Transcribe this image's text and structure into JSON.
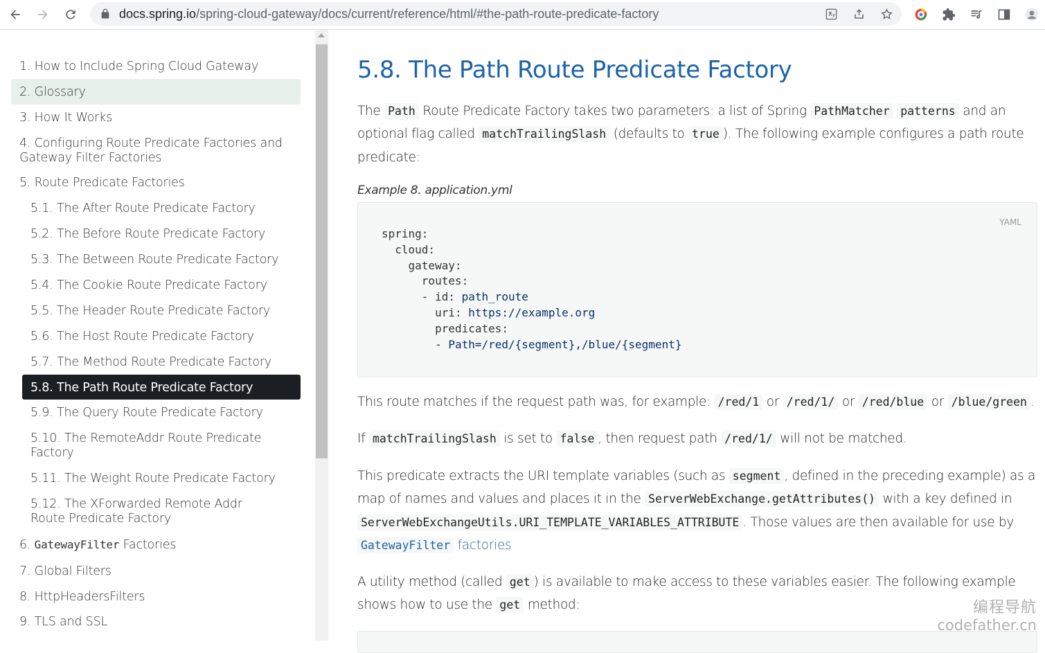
{
  "browser": {
    "url_host": "docs.spring.io",
    "url_path": "/spring-cloud-gateway/docs/current/reference/html/#the-path-route-predicate-factory"
  },
  "toc": {
    "items": [
      {
        "label": "1. How to Include Spring Cloud Gateway"
      },
      {
        "label": "2. Glossary"
      },
      {
        "label": "3. How It Works"
      },
      {
        "label": "4. Configuring Route Predicate Factories and Gateway Filter Factories"
      },
      {
        "label": "5. Route Predicate Factories"
      },
      {
        "label": "5.1. The After Route Predicate Factory"
      },
      {
        "label": "5.2. The Before Route Predicate Factory"
      },
      {
        "label": "5.3. The Between Route Predicate Factory"
      },
      {
        "label": "5.4. The Cookie Route Predicate Factory"
      },
      {
        "label": "5.5. The Header Route Predicate Factory"
      },
      {
        "label": "5.6. The Host Route Predicate Factory"
      },
      {
        "label": "5.7. The Method Route Predicate Factory"
      },
      {
        "label": "5.8. The Path Route Predicate Factory"
      },
      {
        "label": "5.9. The Query Route Predicate Factory"
      },
      {
        "label": "5.10. The RemoteAddr Route Predicate Factory"
      },
      {
        "label": "5.11. The Weight Route Predicate Factory"
      },
      {
        "label": "5.12. The XForwarded Remote Addr Route Predicate Factory"
      },
      {
        "prefix": "6. ",
        "code": "GatewayFilter",
        "suffix": " Factories"
      },
      {
        "label": "7. Global Filters"
      },
      {
        "label": "8. HttpHeadersFilters"
      },
      {
        "label": "9. TLS and SSL"
      }
    ]
  },
  "content": {
    "title": "5.8. The Path Route Predicate Factory",
    "p1": {
      "t1": "The ",
      "c1": "Path",
      "t2": " Route Predicate Factory takes two parameters: a list of Spring ",
      "c2": "PathMatcher",
      "t3": " ",
      "c3": "patterns",
      "t4": " and an optional flag called ",
      "c4": "matchTrailingSlash",
      "t5": " (defaults to ",
      "c5": "true",
      "t6": "). The following example configures a path route predicate:"
    },
    "example_title": "Example 8. application.yml",
    "code_lang": "YAML",
    "code_lines": {
      "l1": "spring:",
      "l2": "  cloud:",
      "l3": "    gateway:",
      "l4": "      routes:",
      "l5k": "      - id: ",
      "l5v": "path_route",
      "l6k": "        uri: ",
      "l6v": "https://example.org",
      "l7": "        predicates:",
      "l8": "        - Path=/red/{segment},/blue/{segment}"
    },
    "p2": {
      "t1": "This route matches if the request path was, for example: ",
      "c1": "/red/1",
      "t2": " or ",
      "c2": "/red/1/",
      "t3": " or ",
      "c3": "/red/blue",
      "t4": " or ",
      "c4": "/blue/green",
      "t5": "."
    },
    "p3": {
      "t1": "If ",
      "c1": "matchTrailingSlash",
      "t2": " is set to ",
      "c2": "false",
      "t3": ", then request path ",
      "c3": "/red/1/",
      "t4": " will not be matched."
    },
    "p4": {
      "t1": "This predicate extracts the URI template variables (such as ",
      "c1": "segment",
      "t2": ", defined in the preceding example) as a map of names and values and places it in the ",
      "c2": "ServerWebExchange.getAttributes()",
      "t3": " with a key defined in ",
      "c3": "ServerWebExchangeUtils.URI_TEMPLATE_VARIABLES_ATTRIBUTE",
      "t4": ". Those values are then available for use by ",
      "link_code": "GatewayFilter",
      "link_text": " factories"
    },
    "p5": {
      "t1": "A utility method (called ",
      "c1": "get",
      "t2": ") is available to make access to these variables easier. The following example shows how to use the ",
      "c2": "get",
      "t3": " method:"
    }
  },
  "watermark": {
    "cn": "编程导航",
    "en": "codefather.cn"
  }
}
